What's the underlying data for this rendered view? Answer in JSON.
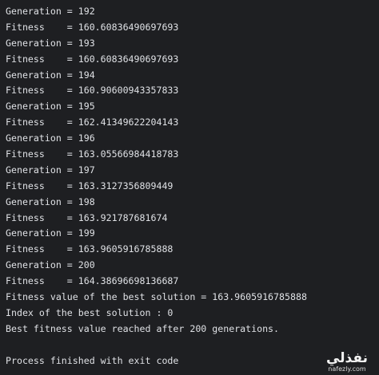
{
  "console": {
    "lines": [
      "Generation = 192",
      "Fitness    = 160.60836490697693",
      "Generation = 193",
      "Fitness    = 160.60836490697693",
      "Generation = 194",
      "Fitness    = 160.90600943357833",
      "Generation = 195",
      "Fitness    = 162.41349622204143",
      "Generation = 196",
      "Fitness    = 163.05566984418783",
      "Generation = 197",
      "Fitness    = 163.3127356809449",
      "Generation = 198",
      "Fitness    = 163.921787681674",
      "Generation = 199",
      "Fitness    = 163.9605916785888",
      "Generation = 200",
      "Fitness    = 164.38696698136687",
      "Fitness value of the best solution = 163.9605916785888",
      "Index of the best solution : 0",
      "Best fitness value reached after 200 generations."
    ],
    "exit_line": "Process finished with exit code"
  },
  "watermark": {
    "arabic": "نفذلي",
    "latin": "nafezly.com"
  }
}
